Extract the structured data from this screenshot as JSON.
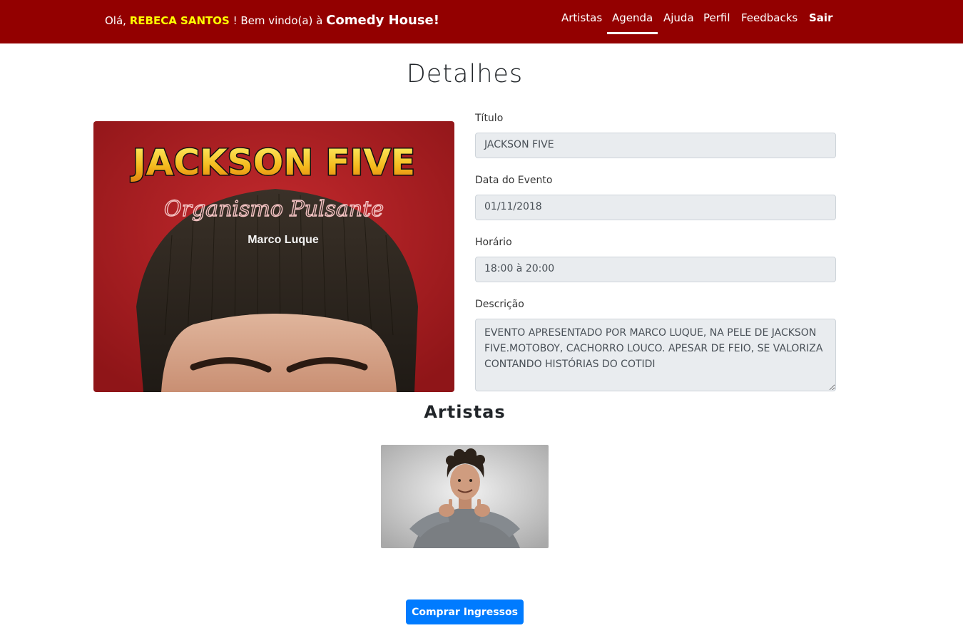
{
  "header": {
    "greeting_prefix": "Olá,",
    "user_name": "REBECA SANTOS",
    "greeting_middle": "! Bem vindo(a) à",
    "brand": "Comedy House!",
    "bg_color": "#930000",
    "user_color": "#ffff00"
  },
  "nav": {
    "items": [
      {
        "label": "Artistas"
      },
      {
        "label": "Agenda",
        "active": true
      },
      {
        "label": "Ajuda"
      },
      {
        "label": "Perfil"
      },
      {
        "label": "Feedbacks"
      },
      {
        "label": "Sair"
      }
    ]
  },
  "page": {
    "title": "Detalhes"
  },
  "poster": {
    "headline": "JACKSON FIVE",
    "subtitle": "Organismo Pulsante",
    "author": "Marco Luque"
  },
  "form": {
    "titulo_label": "Título",
    "titulo_value": "JACKSON FIVE",
    "data_label": "Data do Evento",
    "data_value": "01/11/2018",
    "horario_label": "Horário",
    "horario_value": "18:00 à 20:00",
    "descricao_label": "Descrição",
    "descricao_value": "EVENTO APRESENTADO POR MARCO LUQUE, NA PELE DE JACKSON FIVE.MOTOBOY, CACHORRO LOUCO. APESAR DE FEIO, SE VALORIZA CONTANDO HISTÓRIAS DO COTIDI"
  },
  "artists": {
    "section_title": "Artistas"
  },
  "actions": {
    "buy_label": "Comprar Ingressos",
    "buy_color": "#007bff"
  }
}
